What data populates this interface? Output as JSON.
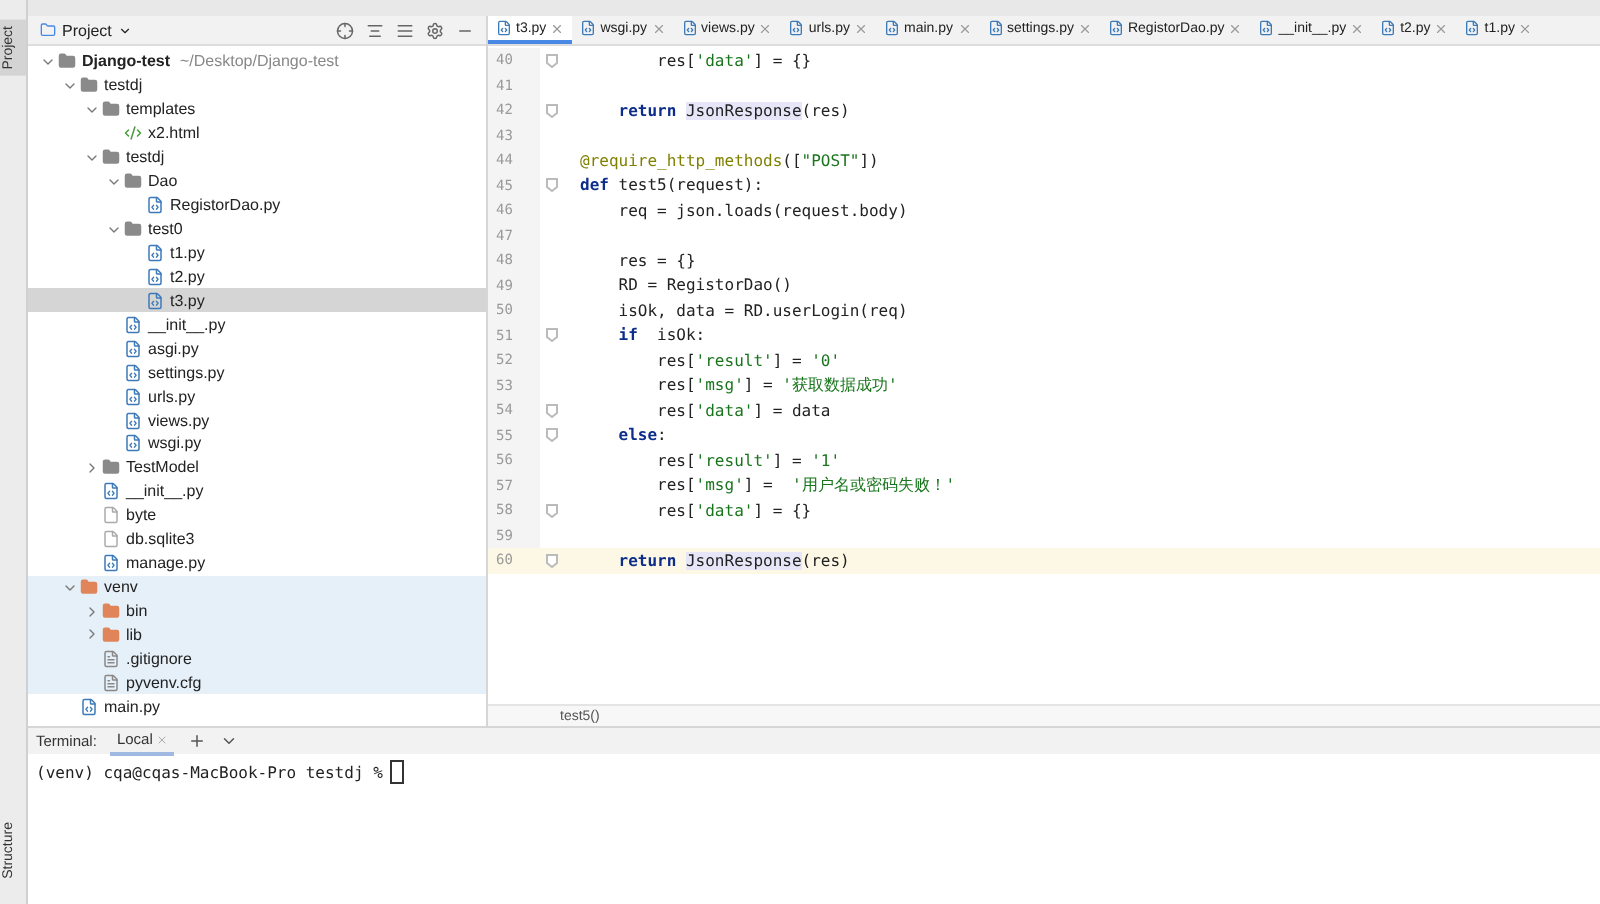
{
  "tool_strip": {
    "top": "Project",
    "bottom": "Structure"
  },
  "project_panel": {
    "title": "Project"
  },
  "tree": [
    {
      "label": "Django-test",
      "path": "~/Desktop/Django-test",
      "kind": "folder",
      "expanded": true,
      "selected": false,
      "highlighted": false,
      "children": [
        {
          "label": "testdj",
          "kind": "folder",
          "expanded": true,
          "selected": false,
          "highlighted": false,
          "children": [
            {
              "label": "templates",
              "kind": "folder",
              "expanded": true,
              "selected": false,
              "highlighted": false,
              "children": [
                {
                  "label": "x2.html",
                  "kind": "html",
                  "selected": false,
                  "highlighted": false
                }
              ]
            },
            {
              "label": "testdj",
              "kind": "folder",
              "expanded": true,
              "selected": false,
              "highlighted": false,
              "children": [
                {
                  "label": "Dao",
                  "kind": "folder",
                  "expanded": true,
                  "selected": false,
                  "highlighted": false,
                  "children": [
                    {
                      "label": "RegistorDao.py",
                      "kind": "python",
                      "selected": false,
                      "highlighted": false
                    }
                  ]
                },
                {
                  "label": "test0",
                  "kind": "folder",
                  "expanded": true,
                  "selected": false,
                  "highlighted": false,
                  "children": [
                    {
                      "label": "t1.py",
                      "kind": "python",
                      "selected": false,
                      "highlighted": false
                    },
                    {
                      "label": "t2.py",
                      "kind": "python",
                      "selected": false,
                      "highlighted": false
                    },
                    {
                      "label": "t3.py",
                      "kind": "python",
                      "selected": true,
                      "highlighted": false
                    }
                  ]
                },
                {
                  "label": "__init__.py",
                  "kind": "python",
                  "selected": false,
                  "highlighted": false
                },
                {
                  "label": "asgi.py",
                  "kind": "python",
                  "selected": false,
                  "highlighted": false
                },
                {
                  "label": "settings.py",
                  "kind": "python",
                  "selected": false,
                  "highlighted": false
                },
                {
                  "label": "urls.py",
                  "kind": "python",
                  "selected": false,
                  "highlighted": false
                },
                {
                  "label": "views.py",
                  "kind": "python",
                  "selected": false,
                  "highlighted": false
                },
                {
                  "label": "wsgi.py",
                  "kind": "python",
                  "selected": false,
                  "highlighted": false
                }
              ]
            },
            {
              "label": "TestModel",
              "kind": "folder",
              "expanded": false,
              "selected": false,
              "highlighted": false
            },
            {
              "label": "__init__.py",
              "kind": "python",
              "selected": false,
              "highlighted": false
            },
            {
              "label": "byte",
              "kind": "text",
              "selected": false,
              "highlighted": false
            },
            {
              "label": "db.sqlite3",
              "kind": "text",
              "selected": false,
              "highlighted": false
            },
            {
              "label": "manage.py",
              "kind": "python",
              "selected": false,
              "highlighted": false
            }
          ]
        },
        {
          "label": "venv",
          "kind": "venv",
          "expanded": true,
          "selected": false,
          "highlighted": true,
          "children": [
            {
              "label": "bin",
              "kind": "venv",
              "expanded": false,
              "selected": false,
              "highlighted": true
            },
            {
              "label": "lib",
              "kind": "venv",
              "expanded": false,
              "selected": false,
              "highlighted": true
            },
            {
              "label": ".gitignore",
              "kind": "config",
              "selected": false,
              "highlighted": true
            },
            {
              "label": "pyvenv.cfg",
              "kind": "config",
              "selected": false,
              "highlighted": true
            }
          ]
        },
        {
          "label": "main.py",
          "kind": "python",
          "selected": false,
          "highlighted": false
        }
      ]
    }
  ],
  "tabs": [
    {
      "label": "t3.py",
      "selected": true
    },
    {
      "label": "wsgi.py",
      "selected": false
    },
    {
      "label": "views.py",
      "selected": false
    },
    {
      "label": "urls.py",
      "selected": false
    },
    {
      "label": "main.py",
      "selected": false
    },
    {
      "label": "settings.py",
      "selected": false
    },
    {
      "label": "RegistorDao.py",
      "selected": false
    },
    {
      "label": "__init__.py",
      "selected": false
    },
    {
      "label": "t2.py",
      "selected": false
    },
    {
      "label": "t1.py",
      "selected": false
    }
  ],
  "code": [
    {
      "number": "40",
      "fold": true,
      "current": false,
      "tokens": [
        {
          "kind": "plain",
          "text": "        res["
        },
        {
          "kind": "string",
          "text": "'data'"
        },
        {
          "kind": "plain",
          "text": "] = {}"
        }
      ]
    },
    {
      "number": "41",
      "fold": false,
      "current": false
    },
    {
      "number": "42",
      "fold": true,
      "current": false,
      "tokens": [
        {
          "kind": "keyword",
          "text": "    return "
        },
        {
          "kind": "call",
          "text": "JsonResponse"
        },
        {
          "kind": "plain",
          "text": "(res)"
        }
      ]
    },
    {
      "number": "43",
      "fold": false,
      "current": false
    },
    {
      "number": "44",
      "fold": false,
      "current": false,
      "tokens": [
        {
          "kind": "decorator",
          "text": "@require_http_methods"
        },
        {
          "kind": "plain",
          "text": "(["
        },
        {
          "kind": "string",
          "text": "\"POST\""
        },
        {
          "kind": "plain",
          "text": "])"
        }
      ]
    },
    {
      "number": "45",
      "fold": true,
      "current": false,
      "tokens": [
        {
          "kind": "keyword",
          "text": "def"
        },
        {
          "kind": "plain",
          "text": " test5(request):"
        }
      ]
    },
    {
      "number": "46",
      "fold": false,
      "current": false,
      "tokens": [
        {
          "kind": "plain",
          "text": "    req = json.loads(request.body)"
        }
      ]
    },
    {
      "number": "47",
      "fold": false,
      "current": false
    },
    {
      "number": "48",
      "fold": false,
      "current": false,
      "tokens": [
        {
          "kind": "plain",
          "text": "    res = {}"
        }
      ]
    },
    {
      "number": "49",
      "fold": false,
      "current": false,
      "tokens": [
        {
          "kind": "plain",
          "text": "    RD = RegistorDao()"
        }
      ]
    },
    {
      "number": "50",
      "fold": false,
      "current": false,
      "tokens": [
        {
          "kind": "plain",
          "text": "    isOk, data = RD.userLogin(req)"
        }
      ]
    },
    {
      "number": "51",
      "fold": true,
      "current": false,
      "tokens": [
        {
          "kind": "keyword",
          "text": "    if"
        },
        {
          "kind": "plain",
          "text": "  isOk:"
        }
      ]
    },
    {
      "number": "52",
      "fold": false,
      "current": false,
      "tokens": [
        {
          "kind": "plain",
          "text": "        res["
        },
        {
          "kind": "string",
          "text": "'result'"
        },
        {
          "kind": "plain",
          "text": "] = "
        },
        {
          "kind": "string",
          "text": "'0'"
        }
      ]
    },
    {
      "number": "53",
      "fold": false,
      "current": false,
      "tokens": [
        {
          "kind": "plain",
          "text": "        res["
        },
        {
          "kind": "string",
          "text": "'msg'"
        },
        {
          "kind": "plain",
          "text": "] = "
        },
        {
          "kind": "string",
          "text": "'获取数据成功'"
        }
      ]
    },
    {
      "number": "54",
      "fold": true,
      "current": false,
      "tokens": [
        {
          "kind": "plain",
          "text": "        res["
        },
        {
          "kind": "string",
          "text": "'data'"
        },
        {
          "kind": "plain",
          "text": "] = data"
        }
      ]
    },
    {
      "number": "55",
      "fold": true,
      "current": false,
      "tokens": [
        {
          "kind": "keyword",
          "text": "    else"
        },
        {
          "kind": "plain",
          "text": ":"
        }
      ]
    },
    {
      "number": "56",
      "fold": false,
      "current": false,
      "tokens": [
        {
          "kind": "plain",
          "text": "        res["
        },
        {
          "kind": "string",
          "text": "'result'"
        },
        {
          "kind": "plain",
          "text": "] = "
        },
        {
          "kind": "string",
          "text": "'1'"
        }
      ]
    },
    {
      "number": "57",
      "fold": false,
      "current": false,
      "tokens": [
        {
          "kind": "plain",
          "text": "        res["
        },
        {
          "kind": "string",
          "text": "'msg'"
        },
        {
          "kind": "plain",
          "text": "] =  "
        },
        {
          "kind": "string",
          "text": "'用户名或密码失败！'"
        }
      ]
    },
    {
      "number": "58",
      "fold": true,
      "current": false,
      "tokens": [
        {
          "kind": "plain",
          "text": "        res["
        },
        {
          "kind": "string",
          "text": "'data'"
        },
        {
          "kind": "plain",
          "text": "] = {}"
        }
      ]
    },
    {
      "number": "59",
      "fold": false,
      "current": false
    },
    {
      "number": "60",
      "fold": true,
      "current": true,
      "tokens": [
        {
          "kind": "keyword",
          "text": "    return "
        },
        {
          "kind": "call",
          "text": "JsonResponse"
        },
        {
          "kind": "plain",
          "text": "(res)"
        }
      ]
    }
  ],
  "breadcrumb": "test5()",
  "terminal": {
    "title": "Terminal:",
    "tabs": [
      {
        "label": "Local",
        "selected": true
      }
    ],
    "prompt": "(venv) cqa@cqas-MacBook-Pro testdj %"
  }
}
